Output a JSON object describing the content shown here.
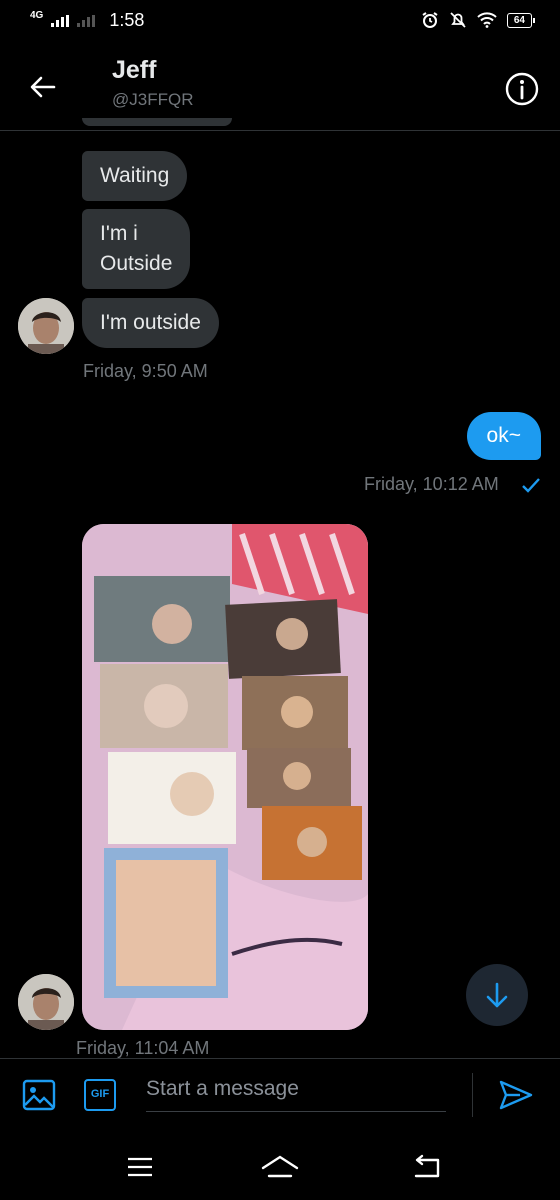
{
  "status_bar": {
    "network": "4G",
    "time": "1:58",
    "battery": "64"
  },
  "header": {
    "name": "Jeff",
    "handle": "@J3FFQR"
  },
  "messages": {
    "received_1": "Waiting",
    "received_2_line1": "I'm i",
    "received_2_line2": "Outside",
    "received_3": "I'm outside",
    "timestamp_1": "Friday, 9:50 AM",
    "sent_1": "ok~",
    "timestamp_2": "Friday, 10:12 AM",
    "timestamp_3": "Friday, 11:04 AM"
  },
  "composer": {
    "gif_label": "GIF",
    "placeholder": "Start a message"
  },
  "colors": {
    "accent": "#1d9bf0",
    "bubble": "#2f3336",
    "background": "#000000"
  }
}
